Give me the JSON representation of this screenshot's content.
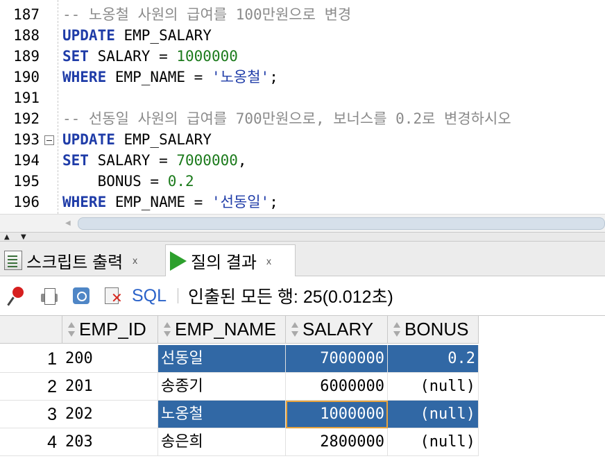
{
  "editor": {
    "lines": [
      {
        "no": "187",
        "tokens": [
          {
            "t": "-- 노옹철 사원의 급여를 100만원으로 변경",
            "c": "cmt"
          }
        ]
      },
      {
        "no": "188",
        "tokens": [
          {
            "t": "UPDATE",
            "c": "kw"
          },
          {
            "t": " EMP_SALARY",
            "c": ""
          }
        ]
      },
      {
        "no": "189",
        "tokens": [
          {
            "t": "SET",
            "c": "kw"
          },
          {
            "t": " SALARY = ",
            "c": ""
          },
          {
            "t": "1000000",
            "c": "num"
          }
        ]
      },
      {
        "no": "190",
        "tokens": [
          {
            "t": "WHERE",
            "c": "kw"
          },
          {
            "t": " EMP_NAME = ",
            "c": ""
          },
          {
            "t": "'노옹철'",
            "c": "str"
          },
          {
            "t": ";",
            "c": ""
          }
        ]
      },
      {
        "no": "191",
        "tokens": []
      },
      {
        "no": "192",
        "tokens": [
          {
            "t": "-- 선동일 사원의 급여를 700만원으로, 보너스를 0.2로 변경하시오",
            "c": "cmt"
          }
        ]
      },
      {
        "no": "193",
        "fold": true,
        "tokens": [
          {
            "t": "UPDATE",
            "c": "kw"
          },
          {
            "t": " EMP_SALARY",
            "c": ""
          }
        ]
      },
      {
        "no": "194",
        "tokens": [
          {
            "t": "SET",
            "c": "kw"
          },
          {
            "t": " SALARY = ",
            "c": ""
          },
          {
            "t": "7000000",
            "c": "num"
          },
          {
            "t": ",",
            "c": ""
          }
        ]
      },
      {
        "no": "195",
        "tokens": [
          {
            "t": "    BONUS = ",
            "c": ""
          },
          {
            "t": "0.2",
            "c": "num"
          }
        ]
      },
      {
        "no": "196",
        "tokens": [
          {
            "t": "WHERE",
            "c": "kw"
          },
          {
            "t": " EMP_NAME = ",
            "c": ""
          },
          {
            "t": "'선동일'",
            "c": "str"
          },
          {
            "t": ";",
            "c": ""
          }
        ]
      }
    ]
  },
  "tabs": {
    "script_output": "스크립트 출력",
    "query_result": "질의 결과",
    "close": "x"
  },
  "toolbar": {
    "sql_label": "SQL",
    "status": "인출된 모든 행: 25(0.012초)"
  },
  "grid": {
    "columns": [
      "EMP_ID",
      "EMP_NAME",
      "SALARY",
      "BONUS"
    ],
    "rows": [
      {
        "no": "1",
        "emp_id": "200",
        "emp_name": "선동일",
        "salary": "7000000",
        "bonus": "0.2"
      },
      {
        "no": "2",
        "emp_id": "201",
        "emp_name": "송종기",
        "salary": "6000000",
        "bonus": "(null)"
      },
      {
        "no": "3",
        "emp_id": "202",
        "emp_name": "노옹철",
        "salary": "1000000",
        "bonus": "(null)"
      },
      {
        "no": "4",
        "emp_id": "203",
        "emp_name": "송은희",
        "salary": "2800000",
        "bonus": "(null)"
      }
    ]
  },
  "colors": {
    "keyword": "#1f3ca8",
    "number": "#1b7a1b",
    "comment": "#8a8a8a",
    "selection": "#3168a5",
    "focus": "#e8a33c"
  }
}
